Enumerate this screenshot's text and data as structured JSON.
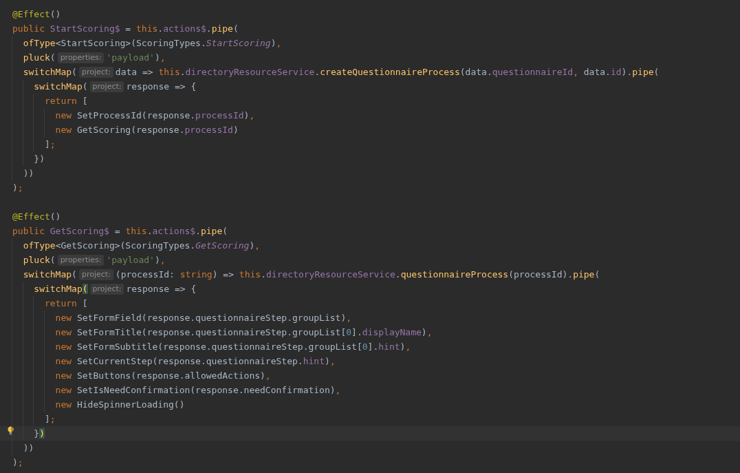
{
  "editor": {
    "lines": [
      {
        "kind": "code",
        "current": false,
        "tokens": [
          {
            "kind": "an",
            "text": "@Effect"
          },
          {
            "kind": "txt",
            "text": "()"
          }
        ]
      },
      {
        "kind": "code",
        "current": false,
        "tokens": [
          {
            "kind": "kw",
            "text": "public "
          },
          {
            "kind": "fld",
            "text": "StartScoring$"
          },
          {
            "kind": "txt",
            "text": " = "
          },
          {
            "kind": "kw",
            "text": "this"
          },
          {
            "kind": "txt",
            "text": "."
          },
          {
            "kind": "fld",
            "text": "actions$"
          },
          {
            "kind": "txt",
            "text": "."
          },
          {
            "kind": "fn",
            "text": "pipe"
          },
          {
            "kind": "txt",
            "text": "("
          }
        ]
      },
      {
        "kind": "code",
        "current": false,
        "tokens": [
          {
            "kind": "fn",
            "text": "  ofType"
          },
          {
            "kind": "txt",
            "text": "<StartScoring>(ScoringTypes."
          },
          {
            "kind": "fldi",
            "text": "StartScoring"
          },
          {
            "kind": "txt",
            "text": ")"
          },
          {
            "kind": "kw",
            "text": ","
          }
        ]
      },
      {
        "kind": "code",
        "current": false,
        "tokens": [
          {
            "kind": "fn",
            "text": "  pluck"
          },
          {
            "kind": "txt",
            "text": "("
          },
          {
            "kind": "hint",
            "text": "properties:"
          },
          {
            "kind": "str",
            "text": "'payload'"
          },
          {
            "kind": "txt",
            "text": ")"
          },
          {
            "kind": "kw",
            "text": ","
          }
        ]
      },
      {
        "kind": "code",
        "current": false,
        "tokens": [
          {
            "kind": "fn",
            "text": "  switchMap"
          },
          {
            "kind": "txt",
            "text": "("
          },
          {
            "kind": "hint",
            "text": "project:"
          },
          {
            "kind": "txt",
            "text": "data => "
          },
          {
            "kind": "kw",
            "text": "this"
          },
          {
            "kind": "txt",
            "text": "."
          },
          {
            "kind": "fld",
            "text": "directoryResourceService"
          },
          {
            "kind": "txt",
            "text": "."
          },
          {
            "kind": "fn",
            "text": "createQuestionnaireProcess"
          },
          {
            "kind": "txt",
            "text": "(data."
          },
          {
            "kind": "fld",
            "text": "questionnaireId"
          },
          {
            "kind": "kw",
            "text": ", "
          },
          {
            "kind": "txt",
            "text": "data."
          },
          {
            "kind": "fld",
            "text": "id"
          },
          {
            "kind": "txt",
            "text": ")."
          },
          {
            "kind": "fn",
            "text": "pipe"
          },
          {
            "kind": "txt",
            "text": "("
          }
        ]
      },
      {
        "kind": "code",
        "current": false,
        "tokens": [
          {
            "kind": "fn",
            "text": "    switchMap"
          },
          {
            "kind": "txt",
            "text": "("
          },
          {
            "kind": "hint",
            "text": "project:"
          },
          {
            "kind": "txt",
            "text": "response => {"
          }
        ]
      },
      {
        "kind": "code",
        "current": false,
        "tokens": [
          {
            "kind": "kw",
            "text": "      return "
          },
          {
            "kind": "txt",
            "text": "["
          }
        ]
      },
      {
        "kind": "code",
        "current": false,
        "tokens": [
          {
            "kind": "kw",
            "text": "        new "
          },
          {
            "kind": "txt",
            "text": "SetProcessId(response."
          },
          {
            "kind": "fld",
            "text": "processId"
          },
          {
            "kind": "txt",
            "text": ")"
          },
          {
            "kind": "kw",
            "text": ","
          }
        ]
      },
      {
        "kind": "code",
        "current": false,
        "tokens": [
          {
            "kind": "kw",
            "text": "        new "
          },
          {
            "kind": "txt",
            "text": "GetScoring(response."
          },
          {
            "kind": "fld",
            "text": "processId"
          },
          {
            "kind": "txt",
            "text": ")"
          }
        ]
      },
      {
        "kind": "code",
        "current": false,
        "tokens": [
          {
            "kind": "txt",
            "text": "      ]"
          },
          {
            "kind": "kw",
            "text": ";"
          }
        ]
      },
      {
        "kind": "code",
        "current": false,
        "tokens": [
          {
            "kind": "txt",
            "text": "    })"
          }
        ]
      },
      {
        "kind": "code",
        "current": false,
        "tokens": [
          {
            "kind": "txt",
            "text": "  ))"
          }
        ]
      },
      {
        "kind": "code",
        "current": false,
        "tokens": [
          {
            "kind": "txt",
            "text": ")"
          },
          {
            "kind": "kw",
            "text": ";"
          }
        ]
      },
      {
        "kind": "blank",
        "current": false
      },
      {
        "kind": "code",
        "current": false,
        "tokens": [
          {
            "kind": "an",
            "text": "@Effect"
          },
          {
            "kind": "txt",
            "text": "()"
          }
        ]
      },
      {
        "kind": "code",
        "current": false,
        "tokens": [
          {
            "kind": "kw",
            "text": "public "
          },
          {
            "kind": "fld",
            "text": "GetScoring$"
          },
          {
            "kind": "txt",
            "text": " = "
          },
          {
            "kind": "kw",
            "text": "this"
          },
          {
            "kind": "txt",
            "text": "."
          },
          {
            "kind": "fld",
            "text": "actions$"
          },
          {
            "kind": "txt",
            "text": "."
          },
          {
            "kind": "fn",
            "text": "pipe"
          },
          {
            "kind": "txt",
            "text": "("
          }
        ]
      },
      {
        "kind": "code",
        "current": false,
        "tokens": [
          {
            "kind": "fn",
            "text": "  ofType"
          },
          {
            "kind": "txt",
            "text": "<GetScoring>(ScoringTypes."
          },
          {
            "kind": "fldi",
            "text": "GetScoring"
          },
          {
            "kind": "txt",
            "text": ")"
          },
          {
            "kind": "kw",
            "text": ","
          }
        ]
      },
      {
        "kind": "code",
        "current": false,
        "tokens": [
          {
            "kind": "fn",
            "text": "  pluck"
          },
          {
            "kind": "txt",
            "text": "("
          },
          {
            "kind": "hint",
            "text": "properties:"
          },
          {
            "kind": "str",
            "text": "'payload'"
          },
          {
            "kind": "txt",
            "text": ")"
          },
          {
            "kind": "kw",
            "text": ","
          }
        ]
      },
      {
        "kind": "code",
        "current": false,
        "tokens": [
          {
            "kind": "fn",
            "text": "  switchMap"
          },
          {
            "kind": "txt",
            "text": "("
          },
          {
            "kind": "hint",
            "text": "project:"
          },
          {
            "kind": "txt",
            "text": "(processId: "
          },
          {
            "kind": "kw",
            "text": "string"
          },
          {
            "kind": "txt",
            "text": ") => "
          },
          {
            "kind": "kw",
            "text": "this"
          },
          {
            "kind": "txt",
            "text": "."
          },
          {
            "kind": "fld",
            "text": "directoryResourceService"
          },
          {
            "kind": "txt",
            "text": "."
          },
          {
            "kind": "fn",
            "text": "questionnaireProcess"
          },
          {
            "kind": "txt",
            "text": "(processId)."
          },
          {
            "kind": "fn",
            "text": "pipe"
          },
          {
            "kind": "txt",
            "text": "("
          }
        ]
      },
      {
        "kind": "code",
        "current": false,
        "tokens": [
          {
            "kind": "fn",
            "text": "    switchMap"
          },
          {
            "kind": "match",
            "text": "("
          },
          {
            "kind": "hint",
            "text": "project:"
          },
          {
            "kind": "txt",
            "text": "response => {"
          }
        ]
      },
      {
        "kind": "code",
        "current": false,
        "tokens": [
          {
            "kind": "kw",
            "text": "      return "
          },
          {
            "kind": "txt",
            "text": "["
          }
        ]
      },
      {
        "kind": "code",
        "current": false,
        "tokens": [
          {
            "kind": "kw",
            "text": "        new "
          },
          {
            "kind": "txt",
            "text": "SetFormField(response.questionnaireStep.groupList)"
          },
          {
            "kind": "kw",
            "text": ","
          }
        ]
      },
      {
        "kind": "code",
        "current": false,
        "tokens": [
          {
            "kind": "kw",
            "text": "        new "
          },
          {
            "kind": "txt",
            "text": "SetFormTitle(response.questionnaireStep.groupList["
          },
          {
            "kind": "num",
            "text": "0"
          },
          {
            "kind": "txt",
            "text": "]."
          },
          {
            "kind": "fld",
            "text": "displayName"
          },
          {
            "kind": "txt",
            "text": ")"
          },
          {
            "kind": "kw",
            "text": ","
          }
        ]
      },
      {
        "kind": "code",
        "current": false,
        "tokens": [
          {
            "kind": "kw",
            "text": "        new "
          },
          {
            "kind": "txt",
            "text": "SetFormSubtitle(response.questionnaireStep.groupList["
          },
          {
            "kind": "num",
            "text": "0"
          },
          {
            "kind": "txt",
            "text": "]."
          },
          {
            "kind": "fld",
            "text": "hint"
          },
          {
            "kind": "txt",
            "text": ")"
          },
          {
            "kind": "kw",
            "text": ","
          }
        ]
      },
      {
        "kind": "code",
        "current": false,
        "tokens": [
          {
            "kind": "kw",
            "text": "        new "
          },
          {
            "kind": "txt",
            "text": "SetCurrentStep(response.questionnaireStep."
          },
          {
            "kind": "fld",
            "text": "hint"
          },
          {
            "kind": "txt",
            "text": ")"
          },
          {
            "kind": "kw",
            "text": ","
          }
        ]
      },
      {
        "kind": "code",
        "current": false,
        "tokens": [
          {
            "kind": "kw",
            "text": "        new "
          },
          {
            "kind": "txt",
            "text": "SetButtons(response.allowedActions)"
          },
          {
            "kind": "kw",
            "text": ","
          }
        ]
      },
      {
        "kind": "code",
        "current": false,
        "tokens": [
          {
            "kind": "kw",
            "text": "        new "
          },
          {
            "kind": "txt",
            "text": "SetIsNeedConfirmation(response.needConfirmation)"
          },
          {
            "kind": "kw",
            "text": ","
          }
        ]
      },
      {
        "kind": "code",
        "current": false,
        "tokens": [
          {
            "kind": "kw",
            "text": "        new "
          },
          {
            "kind": "txt",
            "text": "HideSpinnerLoading()"
          }
        ]
      },
      {
        "kind": "code",
        "current": false,
        "tokens": [
          {
            "kind": "txt",
            "text": "      ]"
          },
          {
            "kind": "kw",
            "text": ";"
          }
        ]
      },
      {
        "kind": "code",
        "current": true,
        "tokens": [
          {
            "kind": "txt",
            "text": "    }"
          },
          {
            "kind": "match",
            "text": ")"
          }
        ]
      },
      {
        "kind": "code",
        "current": false,
        "tokens": [
          {
            "kind": "txt",
            "text": "  ))"
          }
        ]
      },
      {
        "kind": "code",
        "current": false,
        "tokens": [
          {
            "kind": "txt",
            "text": ")"
          },
          {
            "kind": "kw",
            "text": ";"
          }
        ]
      }
    ]
  }
}
